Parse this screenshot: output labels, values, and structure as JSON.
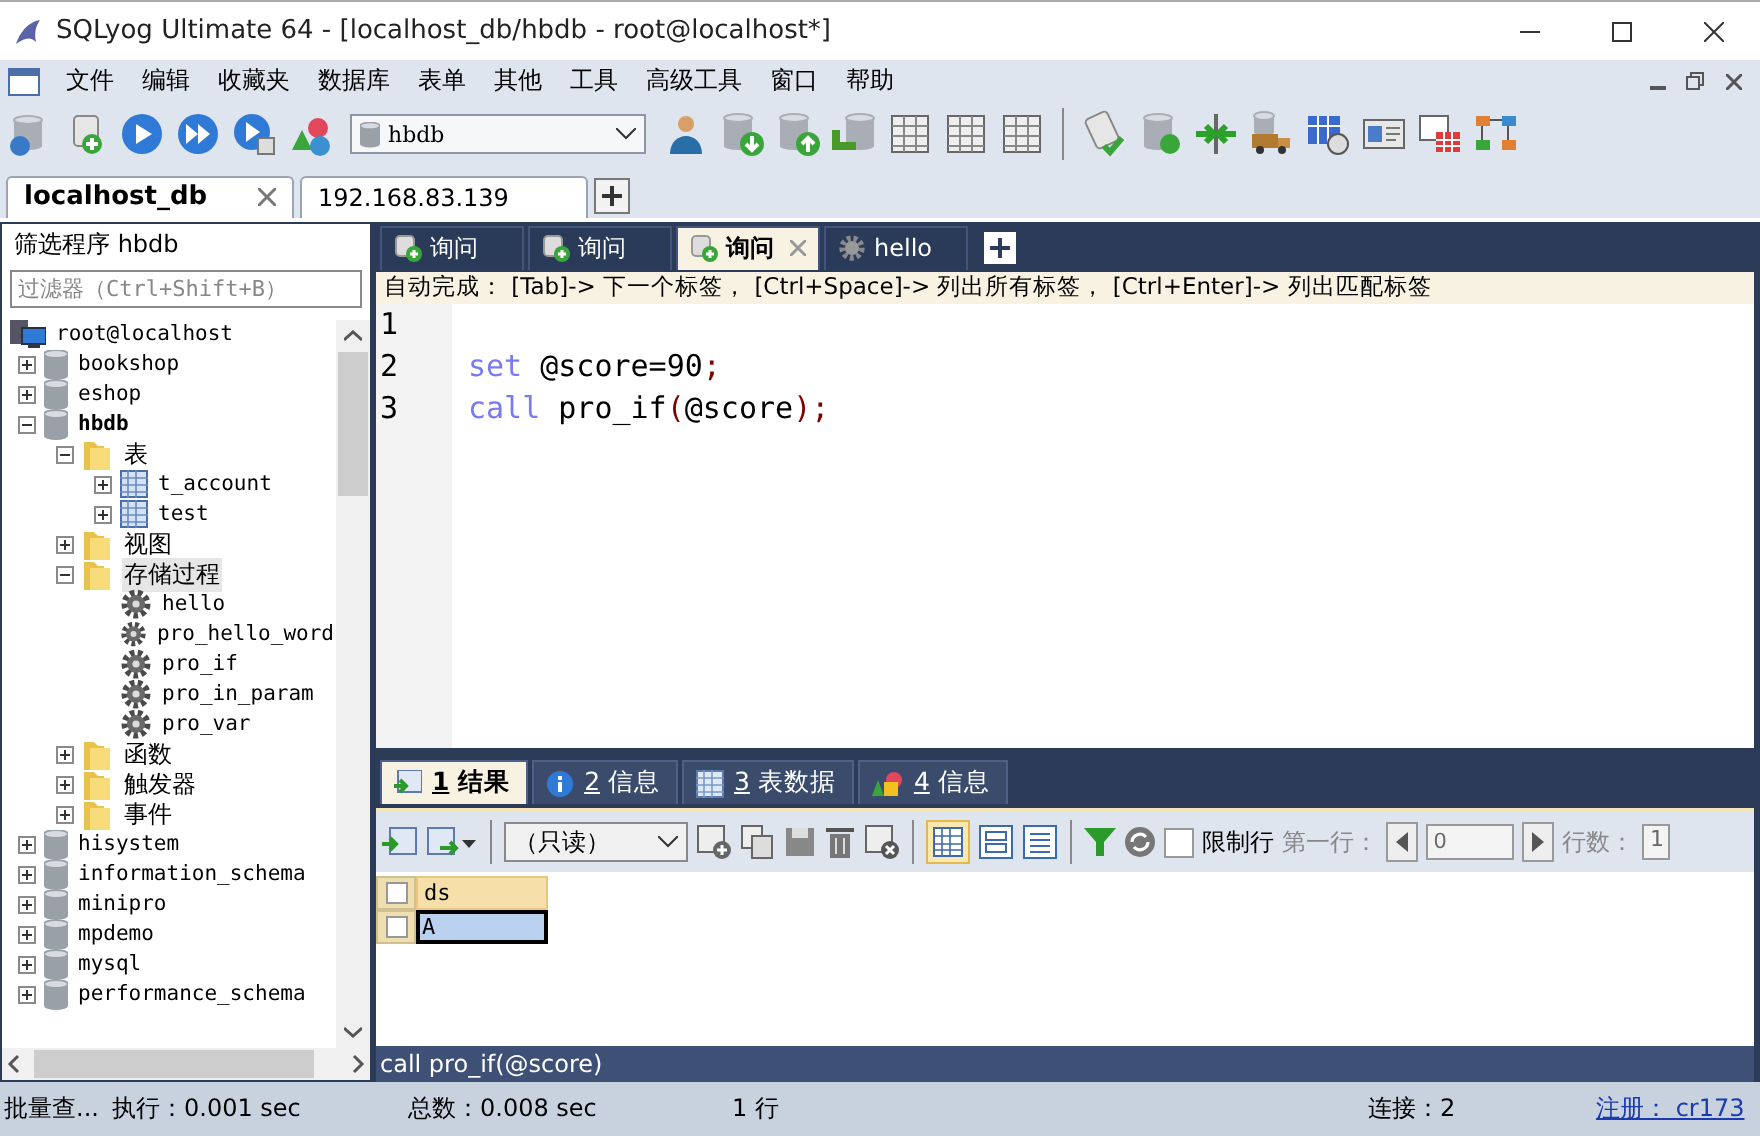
{
  "window": {
    "title": "SQLyog Ultimate 64 - [localhost_db/hbdb - root@localhost*]"
  },
  "menu": [
    "文件",
    "编辑",
    "收藏夹",
    "数据库",
    "表单",
    "其他",
    "工具",
    "高级工具",
    "窗口",
    "帮助"
  ],
  "toolbar": {
    "database_select": "hbdb"
  },
  "connection_tabs": [
    {
      "label": "localhost_db",
      "selected": true
    },
    {
      "label": "192.168.83.139",
      "selected": false
    }
  ],
  "sidebar": {
    "title": "筛选程序 hbdb",
    "filter": {
      "placeholder": "过滤器（Ctrl+Shift+B）"
    },
    "tree": [
      {
        "label": "root@localhost",
        "kind": "server",
        "children": [
          {
            "label": "bookshop",
            "kind": "db",
            "expanded": false
          },
          {
            "label": "eshop",
            "kind": "db",
            "expanded": false
          },
          {
            "label": "hbdb",
            "kind": "db",
            "expanded": true,
            "current": true,
            "children": [
              {
                "label": "表",
                "kind": "folder",
                "expanded": true,
                "children": [
                  {
                    "label": "t_account",
                    "kind": "table",
                    "expanded": false
                  },
                  {
                    "label": "test",
                    "kind": "table",
                    "expanded": false
                  }
                ]
              },
              {
                "label": "视图",
                "kind": "folder",
                "expanded": false
              },
              {
                "label": "存储过程",
                "kind": "folder",
                "expanded": true,
                "selected": true,
                "children": [
                  {
                    "label": "hello",
                    "kind": "proc"
                  },
                  {
                    "label": "pro_hello_word",
                    "kind": "proc"
                  },
                  {
                    "label": "pro_if",
                    "kind": "proc"
                  },
                  {
                    "label": "pro_in_param",
                    "kind": "proc"
                  },
                  {
                    "label": "pro_var",
                    "kind": "proc"
                  }
                ]
              },
              {
                "label": "函数",
                "kind": "folder",
                "expanded": false
              },
              {
                "label": "触发器",
                "kind": "folder",
                "expanded": false
              },
              {
                "label": "事件",
                "kind": "folder",
                "expanded": false
              }
            ]
          },
          {
            "label": "hisystem",
            "kind": "db",
            "expanded": false
          },
          {
            "label": "information_schema",
            "kind": "db",
            "expanded": false
          },
          {
            "label": "minipro",
            "kind": "db",
            "expanded": false
          },
          {
            "label": "mpdemo",
            "kind": "db",
            "expanded": false
          },
          {
            "label": "mysql",
            "kind": "db",
            "expanded": false
          },
          {
            "label": "performance_schema",
            "kind": "db",
            "expanded": false
          }
        ]
      }
    ]
  },
  "query_tabs": [
    {
      "label": "询问",
      "kind": "query",
      "selected": false
    },
    {
      "label": "询问",
      "kind": "query",
      "selected": false
    },
    {
      "label": "询问",
      "kind": "query",
      "selected": true
    },
    {
      "label": "hello",
      "kind": "proc",
      "selected": false
    }
  ],
  "autocomplete_hint": "自动完成： [Tab]-> 下一个标签， [Ctrl+Space]-> 列出所有标签， [Ctrl+Enter]-> 列出匹配标签",
  "editor": {
    "lines": [
      {
        "number": "1"
      },
      {
        "number": "2",
        "tokens": [
          {
            "text": "set",
            "kind": "keyword"
          },
          {
            "text": " @score=90",
            "kind": "plain"
          },
          {
            "text": ";",
            "kind": "punct"
          }
        ]
      },
      {
        "number": "3",
        "tokens": [
          {
            "text": "call",
            "kind": "keyword"
          },
          {
            "text": " pro_if",
            "kind": "plain"
          },
          {
            "text": "(",
            "kind": "punct"
          },
          {
            "text": "@score",
            "kind": "plain"
          },
          {
            "text": ")",
            "kind": "punct"
          },
          {
            "text": ";",
            "kind": "punct"
          }
        ]
      }
    ]
  },
  "result_tabs": [
    {
      "hotkey": "1",
      "label": "结果",
      "kind": "result",
      "selected": true
    },
    {
      "hotkey": "2",
      "label": "信息",
      "kind": "info",
      "selected": false
    },
    {
      "hotkey": "3",
      "label": "表数据",
      "kind": "table",
      "selected": false
    },
    {
      "hotkey": "4",
      "label": "信息",
      "kind": "shapes",
      "selected": false
    }
  ],
  "result_toolbar": {
    "mode": "（只读）",
    "limit_rows": {
      "label": "限制行",
      "checked": false
    },
    "first_row": {
      "label": "第一行：",
      "value": "0"
    },
    "row_count": {
      "label": "行数：",
      "value": "1"
    }
  },
  "table": {
    "all_checked": false,
    "columns": [
      "ds"
    ],
    "rows": [
      {
        "cells": [
          "A"
        ],
        "checked": false,
        "selected": true
      }
    ]
  },
  "query_footer": "call pro_if(@score)",
  "status_bar": {
    "batch": "批量查...",
    "exec": "执行：0.001 sec",
    "total": "总数：0.008 sec",
    "rows": "1 行",
    "connections": "连接：2",
    "register": "注册： cr173"
  }
}
